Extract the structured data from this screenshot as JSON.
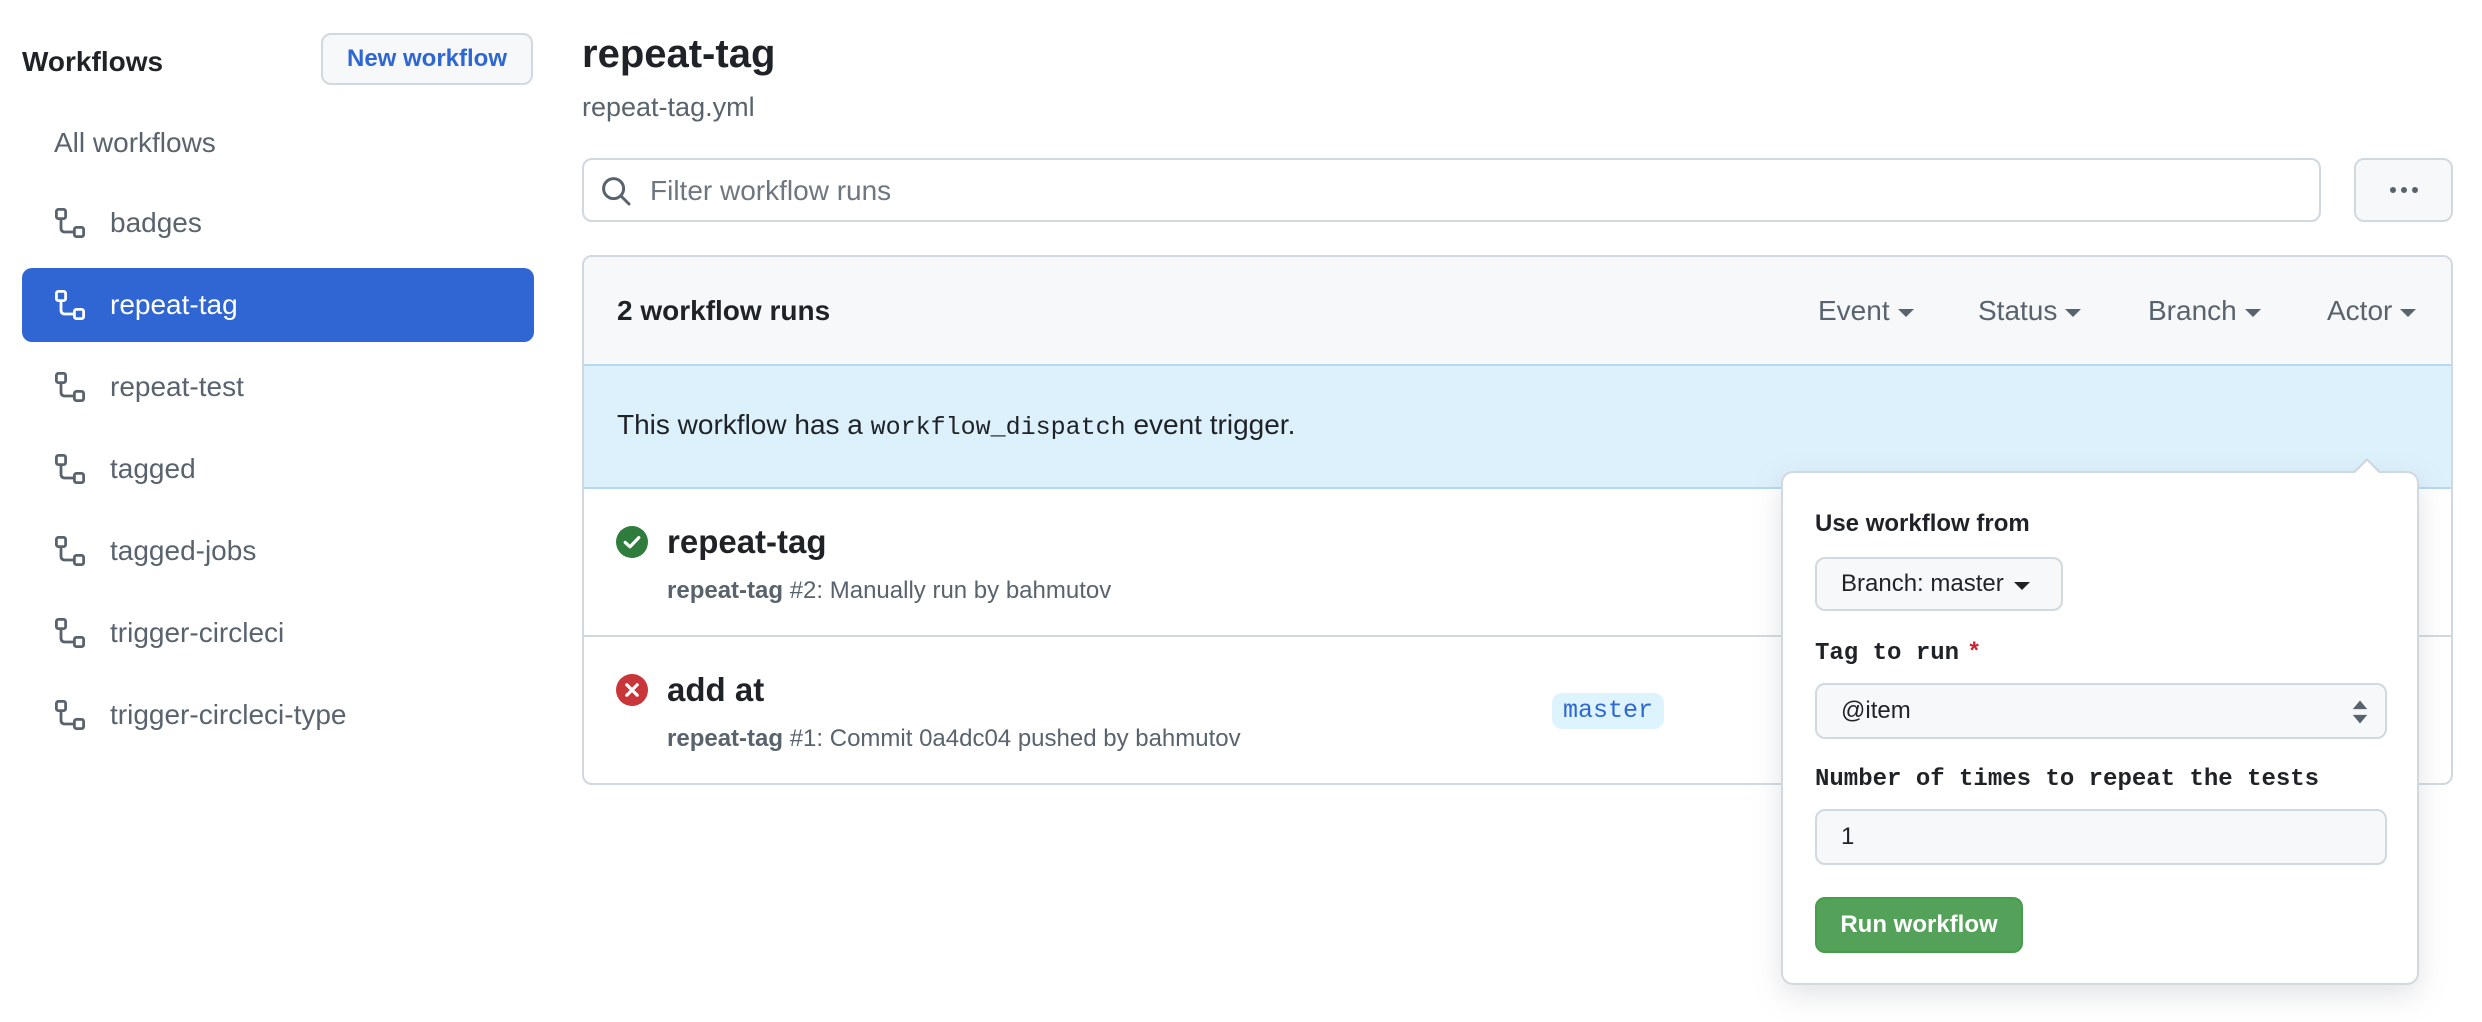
{
  "sidebar": {
    "title": "Workflows",
    "new_workflow_label": "New workflow",
    "all_workflows_label": "All workflows",
    "items": [
      {
        "label": "badges",
        "icon": "workflow-icon",
        "selected": false
      },
      {
        "label": "repeat-tag",
        "icon": "workflow-icon",
        "selected": true
      },
      {
        "label": "repeat-test",
        "icon": "workflow-icon",
        "selected": false
      },
      {
        "label": "tagged",
        "icon": "workflow-icon",
        "selected": false
      },
      {
        "label": "tagged-jobs",
        "icon": "workflow-icon",
        "selected": false
      },
      {
        "label": "trigger-circleci",
        "icon": "workflow-icon",
        "selected": false
      },
      {
        "label": "trigger-circleci-type",
        "icon": "workflow-icon",
        "selected": false
      }
    ]
  },
  "header": {
    "title": "repeat-tag",
    "filename": "repeat-tag.yml"
  },
  "filter": {
    "placeholder": "Filter workflow runs",
    "value": "",
    "icon": "search-icon"
  },
  "more_button": {
    "icon": "kebab-horizontal-icon"
  },
  "runs": {
    "count_label": "2 workflow runs",
    "filters": [
      {
        "label": "Event"
      },
      {
        "label": "Status"
      },
      {
        "label": "Branch"
      },
      {
        "label": "Actor"
      }
    ],
    "banner": {
      "prefix": "This workflow has a ",
      "code": "workflow_dispatch",
      "suffix": " event trigger.",
      "run_button_label": "Run workflow"
    },
    "items": [
      {
        "status": "success",
        "title": "repeat-tag",
        "workflow": "repeat-tag",
        "detail": " #2: Manually run by bahmutov",
        "branch": ""
      },
      {
        "status": "failure",
        "title": "add at",
        "workflow": "repeat-tag",
        "detail": " #1: Commit 0a4dc04 pushed by bahmutov",
        "branch": "master"
      }
    ]
  },
  "run_panel": {
    "use_from_label": "Use workflow from",
    "branch_button_label": "Branch: master",
    "tag_label": "Tag to run",
    "required_marker": "*",
    "tag_value": "@item",
    "repeat_label": "Number of times to repeat the tests",
    "repeat_value": "1",
    "submit_label": "Run workflow"
  },
  "colors": {
    "accent": "#2f66d3",
    "success": "#2f7d3d",
    "failure": "#c9363a",
    "run_button": "#54a15a",
    "banner_bg": "#ddf1fc"
  }
}
